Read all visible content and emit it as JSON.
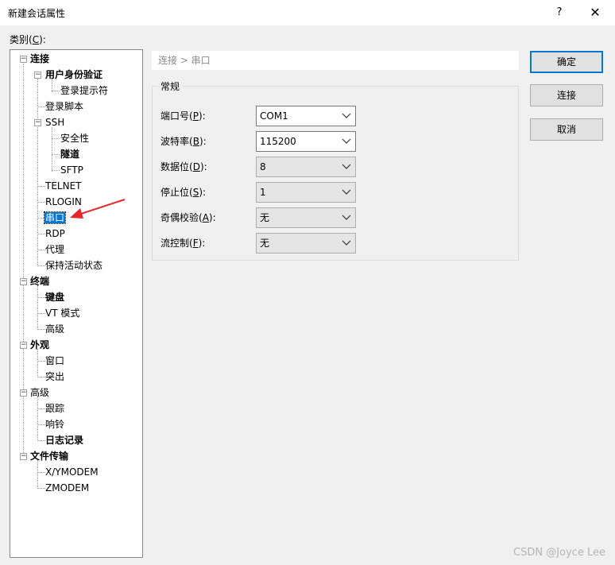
{
  "window": {
    "title": "新建会话属性",
    "help_label": "?",
    "close_label": "✕"
  },
  "category": {
    "label": "类别",
    "mnemonic": "C"
  },
  "tree": [
    {
      "label": "连接",
      "bold": true
    },
    {
      "label": "用户身份验证",
      "bold": true
    },
    {
      "label": "登录提示符"
    },
    {
      "label": "登录脚本"
    },
    {
      "label": "SSH"
    },
    {
      "label": "安全性"
    },
    {
      "label": "隧道",
      "bold": true
    },
    {
      "label": "SFTP"
    },
    {
      "label": "TELNET"
    },
    {
      "label": "RLOGIN"
    },
    {
      "label": "串口",
      "selected": true
    },
    {
      "label": "RDP"
    },
    {
      "label": "代理"
    },
    {
      "label": "保持活动状态"
    },
    {
      "label": "终端",
      "bold": true
    },
    {
      "label": "键盘",
      "bold": true
    },
    {
      "label": "VT 模式"
    },
    {
      "label": "高级"
    },
    {
      "label": "外观",
      "bold": true
    },
    {
      "label": "窗口"
    },
    {
      "label": "突出"
    },
    {
      "label": "高级"
    },
    {
      "label": "跟踪"
    },
    {
      "label": "响铃"
    },
    {
      "label": "日志记录",
      "bold": true
    },
    {
      "label": "文件传输",
      "bold": true
    },
    {
      "label": "X/YMODEM"
    },
    {
      "label": "ZMODEM"
    }
  ],
  "breadcrumb": "连接 > 串口",
  "group_title": "常规",
  "fields": [
    {
      "label": "端口号",
      "mnemonic": "P",
      "value": "COM1"
    },
    {
      "label": "波特率",
      "mnemonic": "B",
      "value": "115200"
    },
    {
      "label": "数据位",
      "mnemonic": "D",
      "value": "8"
    },
    {
      "label": "停止位",
      "mnemonic": "S",
      "value": "1"
    },
    {
      "label": "奇偶校验",
      "mnemonic": "A",
      "value": "无"
    },
    {
      "label": "流控制",
      "mnemonic": "F",
      "value": "无"
    }
  ],
  "buttons": {
    "ok": "确定",
    "connect": "连接",
    "cancel": "取消"
  },
  "watermark": "CSDN @Joyce   Lee",
  "colors": {
    "selection": "#0078d7",
    "arrow": "#e8262a",
    "default_button_border": "#0078d7"
  }
}
